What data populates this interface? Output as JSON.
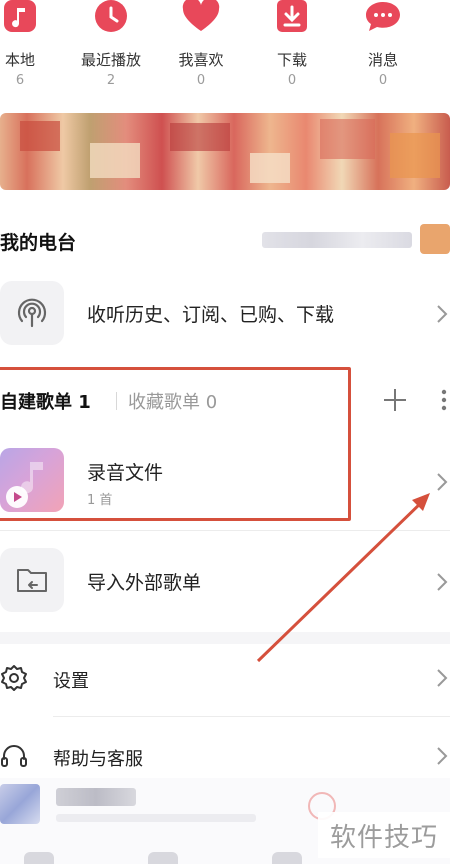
{
  "stats": [
    {
      "icon": "music-note-icon",
      "label": "本地",
      "count": "6"
    },
    {
      "icon": "clock-icon",
      "label": "最近播放",
      "count": "2"
    },
    {
      "icon": "heart-icon",
      "label": "我喜欢",
      "count": "0"
    },
    {
      "icon": "download-icon",
      "label": "下载",
      "count": "0"
    },
    {
      "icon": "message-icon",
      "label": "消息",
      "count": "0"
    }
  ],
  "radio": {
    "title": "我的电台"
  },
  "history": {
    "label": "收听历史、订阅、已购、下载"
  },
  "playlist_tabs": {
    "created": "自建歌单 1",
    "collected": "收藏歌单 0"
  },
  "playlist": {
    "title": "录音文件",
    "subtitle": "1 首"
  },
  "import": {
    "label": "导入外部歌单"
  },
  "settings": {
    "label": "设置"
  },
  "help": {
    "label": "帮助与客服"
  },
  "watermark": {
    "text": "软件技巧"
  },
  "colors": {
    "accent": "#e8485a",
    "highlight": "#d5503c"
  }
}
